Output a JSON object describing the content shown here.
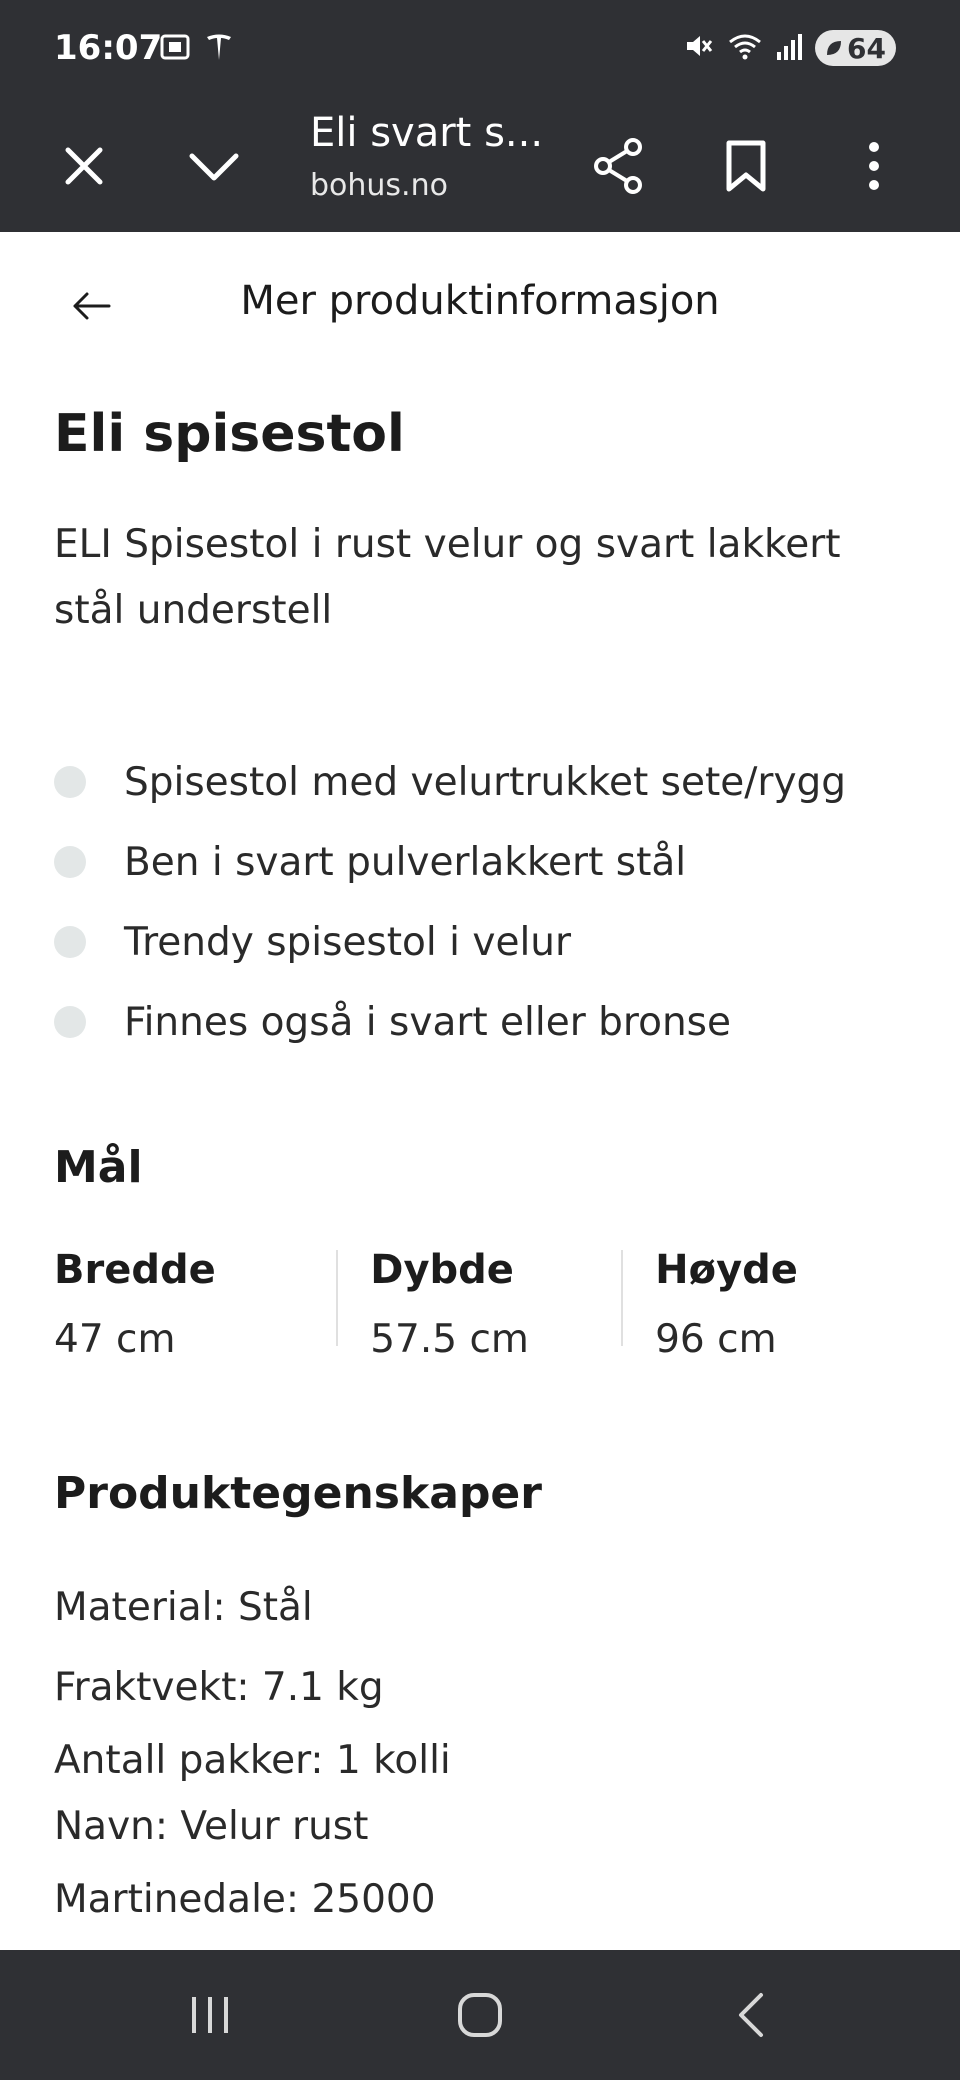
{
  "status_bar": {
    "time": "16:07",
    "battery": "64",
    "icons": [
      "screenshot-icon",
      "tesla-icon",
      "mute-icon",
      "wifi-icon",
      "signal-icon",
      "battery-icon"
    ]
  },
  "browser": {
    "tab_title": "Eli svart s...",
    "url": "bohus.no",
    "icons": [
      "close-icon",
      "chevron-down-icon",
      "share-icon",
      "bookmark-icon",
      "more-vert-icon"
    ]
  },
  "page_header": {
    "title": "Mer produktinformasjon"
  },
  "product": {
    "title": "Eli spisestol",
    "description": "ELI Spisestol i rust velur og svart lakkert stål understell",
    "bullets": [
      "Spisestol med velurtrukket sete/rygg",
      "Ben i svart pulverlakkert stål",
      "Trendy spisestol i velur",
      "Finnes også i svart eller bronse"
    ]
  },
  "measurements": {
    "title": "Mål",
    "items": [
      {
        "label": "Bredde",
        "value": "47 cm"
      },
      {
        "label": "Dybde",
        "value": "57.5 cm"
      },
      {
        "label": "Høyde",
        "value": "96 cm"
      }
    ]
  },
  "properties": {
    "title": "Produktegenskaper",
    "items": [
      "Material: Stål",
      "Fraktvekt: 7.1 kg",
      "Antall pakker: 1 kolli",
      "Navn: Velur rust",
      "Martinedale: 25000"
    ]
  },
  "nav_bar": {
    "icons": [
      "recents-icon",
      "home-icon",
      "back-icon"
    ]
  },
  "colors": {
    "bars": "#2f3034",
    "text": "#1c1c1c",
    "bullet": "#e3e7e7"
  }
}
